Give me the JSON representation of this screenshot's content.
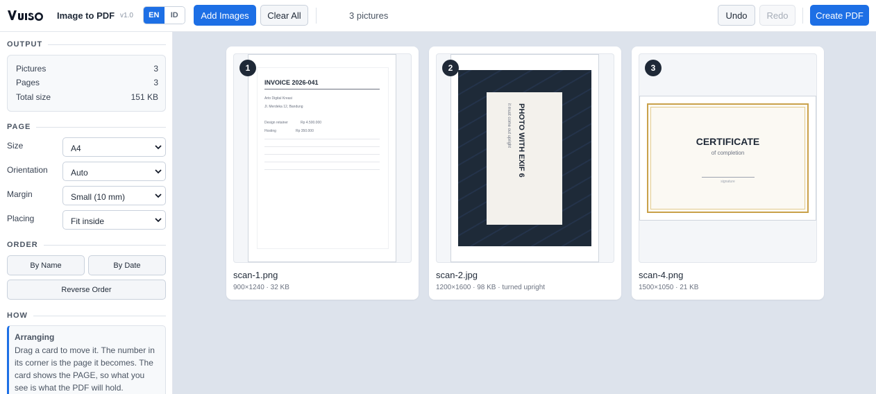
{
  "header": {
    "app_title": "Image to PDF",
    "version": "v1.0",
    "lang_en": "EN",
    "lang_id": "ID",
    "add_images": "Add Images",
    "clear_all": "Clear All",
    "count": "3 pictures",
    "undo": "Undo",
    "redo": "Redo",
    "create_pdf": "Create PDF"
  },
  "sidebar": {
    "output": {
      "title": "OUTPUT",
      "pictures_label": "Pictures",
      "pictures_value": "3",
      "pages_label": "Pages",
      "pages_value": "3",
      "size_label": "Total size",
      "size_value": "151 KB"
    },
    "page": {
      "title": "PAGE",
      "size_label": "Size",
      "size_value": "A4",
      "orientation_label": "Orientation",
      "orientation_value": "Auto",
      "margin_label": "Margin",
      "margin_value": "Small (10 mm)",
      "placing_label": "Placing",
      "placing_value": "Fit inside"
    },
    "order": {
      "title": "ORDER",
      "by_name": "By Name",
      "by_date": "By Date",
      "reverse": "Reverse Order"
    },
    "how": {
      "title": "HOW",
      "heading": "Arranging",
      "text": "Drag a card to move it. The number in its corner is the page it becomes. The card shows the PAGE, so what you see is what the PDF will hold."
    }
  },
  "cards": [
    {
      "number": "1",
      "name": "scan-1.png",
      "meta": "900×1240 · 32 KB",
      "doc_title": "INVOICE 2026-041",
      "line1": "Arto Digital Kreasi",
      "line2": "Jl. Merdeka 12, Bandung",
      "item1_label": "Design retainer",
      "item1_value": "Rp 4.500.000",
      "item2_label": "Hosting",
      "item2_value": "Rp 350.000"
    },
    {
      "number": "2",
      "name": "scan-2.jpg",
      "meta": "1200×1600 · 98 KB · turned upright",
      "photo_title": "PHOTO WITH EXIF 6",
      "photo_sub": "it must come out upright"
    },
    {
      "number": "3",
      "name": "scan-4.png",
      "meta": "1500×1050 · 21 KB",
      "cert_title": "CERTIFICATE",
      "cert_sub": "of completion",
      "cert_sign": "signature"
    }
  ],
  "colors": {
    "accent": "#1d6fe5",
    "badge": "#1f2937",
    "photo_bg": "#1e2a38",
    "cert_border": "#c9a14a"
  }
}
